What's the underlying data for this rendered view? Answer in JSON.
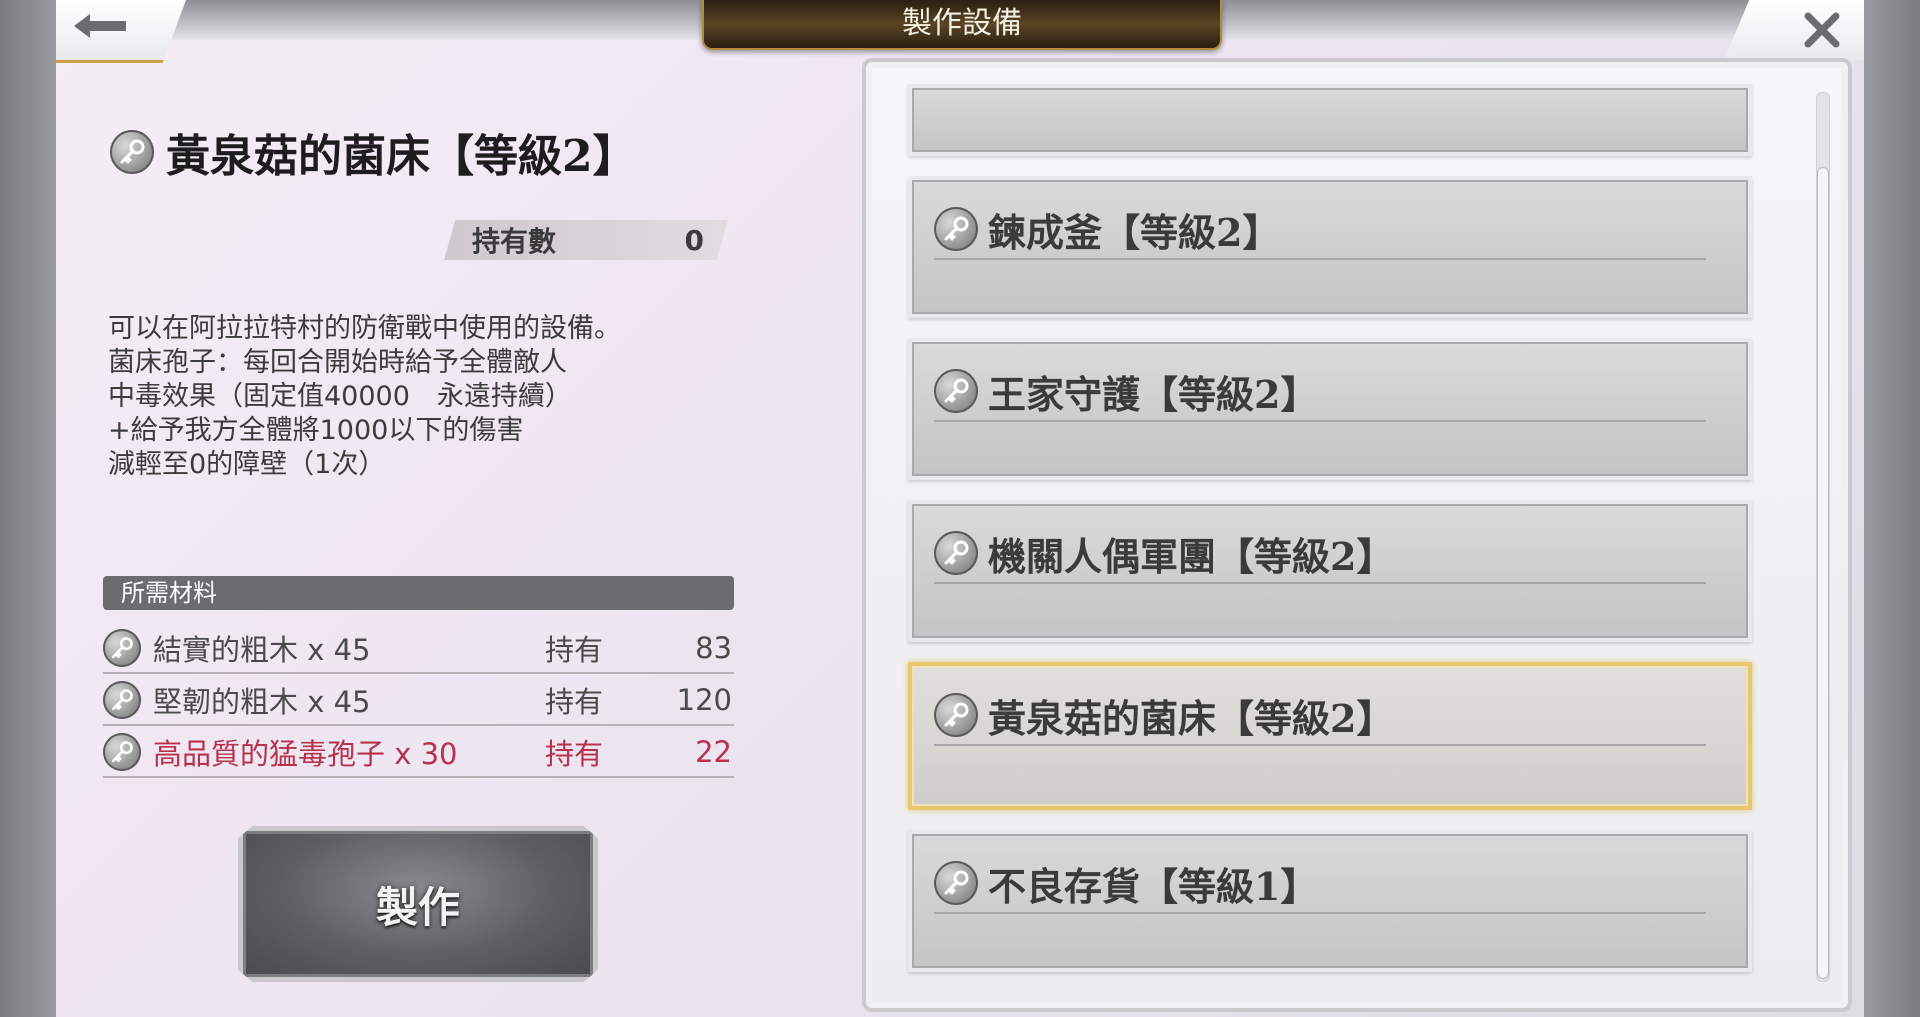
{
  "header": {
    "title": "製作設備"
  },
  "item": {
    "title": "黃泉菇的菌床【等級2】",
    "owned_label": "持有數",
    "owned_value": "0",
    "description": "可以在阿拉拉特村的防衛戰中使用的設備。\n菌床孢子：每回合開始時給予全體敵人\n中毒效果（固定值40000　永遠持續）\n+給予我方全體將1000以下的傷害\n減輕至0的障壁（1次）"
  },
  "materials": {
    "header": "所需材料",
    "rows": [
      {
        "name": "結實的粗木 x 45",
        "owned_label": "持有",
        "owned": "83"
      },
      {
        "name": "堅韌的粗木 x 45",
        "owned_label": "持有",
        "owned": "120"
      },
      {
        "name": "高品質的猛毒孢子 x 30",
        "owned_label": "持有",
        "owned": "22"
      }
    ]
  },
  "make_button": "製作",
  "list": {
    "items": [
      {
        "label": ""
      },
      {
        "label": "鍊成釜【等級2】"
      },
      {
        "label": "王家守護【等級2】"
      },
      {
        "label": "機關人偶軍團【等級2】"
      },
      {
        "label": "黃泉菇的菌床【等級2】"
      },
      {
        "label": "不良存貨【等級1】"
      }
    ]
  },
  "colors": {
    "insufficient_text": "#b8324b",
    "selected_border": "#e7c772",
    "title_plate": "#3a2c18"
  }
}
